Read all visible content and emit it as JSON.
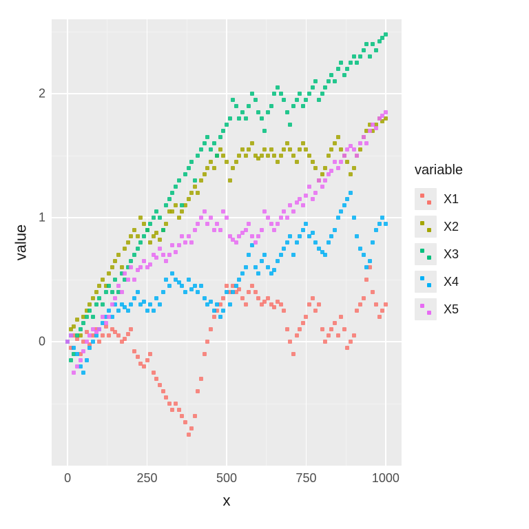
{
  "chart_data": {
    "type": "scatter",
    "xlabel": "x",
    "ylabel": "value",
    "legend_title": "variable",
    "xlim": [
      -50,
      1050
    ],
    "ylim": [
      -1.0,
      2.6
    ],
    "x_ticks": [
      0,
      250,
      500,
      750,
      1000
    ],
    "y_ticks": [
      0,
      1,
      2
    ],
    "x_minor": [
      125,
      375,
      625,
      875
    ],
    "y_minor": [
      -0.5,
      0.5,
      1.5,
      2.5
    ],
    "colors": {
      "X1": "#F8766D",
      "X2": "#A3A500",
      "X3": "#00BF7D",
      "X4": "#00B0F6",
      "X5": "#E76BF3"
    },
    "series": [
      {
        "name": "X1",
        "x": [
          0,
          10,
          20,
          30,
          40,
          50,
          60,
          70,
          80,
          90,
          100,
          110,
          120,
          130,
          140,
          150,
          160,
          170,
          180,
          190,
          200,
          210,
          220,
          230,
          240,
          250,
          260,
          270,
          280,
          290,
          300,
          310,
          320,
          330,
          340,
          350,
          360,
          370,
          380,
          390,
          400,
          410,
          420,
          430,
          440,
          450,
          460,
          470,
          480,
          490,
          500,
          510,
          520,
          530,
          540,
          550,
          560,
          570,
          580,
          590,
          600,
          610,
          620,
          630,
          640,
          650,
          660,
          670,
          680,
          690,
          700,
          710,
          720,
          730,
          740,
          750,
          760,
          770,
          780,
          790,
          800,
          810,
          820,
          830,
          840,
          850,
          860,
          870,
          880,
          890,
          900,
          910,
          920,
          930,
          940,
          950,
          960,
          970,
          980,
          990,
          1000
        ],
        "y": [
          0.0,
          -0.05,
          0.05,
          0.02,
          -0.1,
          0.0,
          0.08,
          -0.02,
          0.05,
          0.1,
          0.0,
          0.05,
          0.12,
          0.05,
          0.1,
          0.08,
          0.05,
          0.0,
          0.02,
          0.06,
          0.1,
          -0.08,
          -0.12,
          -0.18,
          -0.2,
          -0.15,
          -0.1,
          -0.25,
          -0.3,
          -0.35,
          -0.4,
          -0.45,
          -0.5,
          -0.55,
          -0.5,
          -0.55,
          -0.6,
          -0.65,
          -0.75,
          -0.7,
          -0.6,
          -0.4,
          -0.3,
          -0.1,
          0.0,
          0.1,
          0.2,
          0.25,
          0.3,
          0.35,
          0.45,
          0.4,
          0.45,
          0.4,
          0.42,
          0.35,
          0.3,
          0.4,
          0.45,
          0.4,
          0.35,
          0.3,
          0.32,
          0.35,
          0.3,
          0.28,
          0.32,
          0.3,
          0.25,
          0.1,
          0.0,
          -0.1,
          0.05,
          0.1,
          0.15,
          0.2,
          0.3,
          0.35,
          0.25,
          0.3,
          0.1,
          0.0,
          0.05,
          0.1,
          0.15,
          0.05,
          0.2,
          0.1,
          -0.05,
          0.0,
          0.05,
          0.25,
          0.3,
          0.35,
          0.5,
          0.6,
          0.4,
          0.3,
          0.2,
          0.25,
          0.3
        ]
      },
      {
        "name": "X2",
        "x": [
          0,
          10,
          20,
          30,
          40,
          50,
          60,
          70,
          80,
          90,
          100,
          110,
          120,
          130,
          140,
          150,
          160,
          170,
          180,
          190,
          200,
          210,
          220,
          230,
          240,
          250,
          260,
          270,
          280,
          290,
          300,
          310,
          320,
          330,
          340,
          350,
          360,
          370,
          380,
          390,
          400,
          410,
          420,
          430,
          440,
          450,
          460,
          470,
          480,
          490,
          500,
          510,
          520,
          530,
          540,
          550,
          560,
          570,
          580,
          590,
          600,
          610,
          620,
          630,
          640,
          650,
          660,
          670,
          680,
          690,
          700,
          710,
          720,
          730,
          740,
          750,
          760,
          770,
          780,
          790,
          800,
          810,
          820,
          830,
          840,
          850,
          860,
          870,
          880,
          890,
          900,
          910,
          920,
          930,
          940,
          950,
          960,
          970,
          980,
          990,
          1000
        ],
        "y": [
          0.0,
          0.1,
          0.12,
          0.18,
          0.05,
          0.2,
          0.25,
          0.3,
          0.35,
          0.4,
          0.45,
          0.5,
          0.45,
          0.55,
          0.6,
          0.65,
          0.7,
          0.6,
          0.75,
          0.8,
          0.85,
          0.9,
          0.85,
          1.0,
          0.95,
          0.9,
          0.8,
          0.85,
          0.88,
          0.82,
          0.9,
          0.95,
          1.05,
          1.05,
          1.1,
          1.0,
          1.05,
          1.1,
          1.15,
          1.2,
          1.25,
          1.2,
          1.3,
          1.35,
          1.4,
          1.45,
          1.4,
          1.5,
          1.55,
          1.5,
          1.45,
          1.3,
          1.4,
          1.45,
          1.5,
          1.55,
          1.5,
          1.55,
          1.6,
          1.5,
          1.48,
          1.5,
          1.55,
          1.5,
          1.55,
          1.5,
          1.45,
          1.5,
          1.55,
          1.6,
          1.55,
          1.5,
          1.45,
          1.55,
          1.6,
          1.55,
          1.5,
          1.45,
          1.4,
          1.3,
          1.35,
          1.4,
          1.5,
          1.55,
          1.6,
          1.65,
          1.55,
          1.5,
          1.45,
          1.35,
          1.4,
          1.5,
          1.55,
          1.65,
          1.7,
          1.75,
          1.7,
          1.75,
          1.8,
          1.78,
          1.8
        ]
      },
      {
        "name": "X3",
        "x": [
          0,
          10,
          20,
          30,
          40,
          50,
          60,
          70,
          80,
          90,
          100,
          110,
          120,
          130,
          140,
          150,
          160,
          170,
          180,
          190,
          200,
          210,
          220,
          230,
          240,
          250,
          260,
          270,
          280,
          290,
          300,
          310,
          320,
          330,
          340,
          350,
          360,
          370,
          380,
          390,
          400,
          410,
          420,
          430,
          440,
          450,
          460,
          470,
          480,
          490,
          500,
          510,
          520,
          530,
          540,
          550,
          560,
          570,
          580,
          590,
          600,
          610,
          620,
          630,
          640,
          650,
          660,
          670,
          680,
          690,
          700,
          710,
          720,
          730,
          740,
          750,
          760,
          770,
          780,
          790,
          800,
          810,
          820,
          830,
          840,
          850,
          860,
          870,
          880,
          890,
          900,
          910,
          920,
          930,
          940,
          950,
          960,
          970,
          980,
          990,
          1000
        ],
        "y": [
          0.0,
          -0.15,
          -0.1,
          0.05,
          0.1,
          0.15,
          0.2,
          0.25,
          0.2,
          0.3,
          0.35,
          0.3,
          0.4,
          0.45,
          0.4,
          0.5,
          0.4,
          0.55,
          0.5,
          0.6,
          0.65,
          0.7,
          0.75,
          0.8,
          0.85,
          0.9,
          0.95,
          1.0,
          1.05,
          1.0,
          0.9,
          1.1,
          1.15,
          1.2,
          1.25,
          1.3,
          1.1,
          1.35,
          1.4,
          1.45,
          1.3,
          1.5,
          1.55,
          1.6,
          1.65,
          1.55,
          1.6,
          1.5,
          1.65,
          1.7,
          1.75,
          1.8,
          1.95,
          1.9,
          1.8,
          1.85,
          1.8,
          1.9,
          2.0,
          1.95,
          1.85,
          1.8,
          1.7,
          1.85,
          1.9,
          2.0,
          2.05,
          2.0,
          1.95,
          1.85,
          1.75,
          1.9,
          1.95,
          2.0,
          1.9,
          1.95,
          2.0,
          2.05,
          2.1,
          1.95,
          2.0,
          2.05,
          2.1,
          2.15,
          2.1,
          2.2,
          2.25,
          2.15,
          2.2,
          2.25,
          2.3,
          2.25,
          2.3,
          2.35,
          2.4,
          2.3,
          2.4,
          2.35,
          2.42,
          2.45,
          2.48
        ]
      },
      {
        "name": "X4",
        "x": [
          0,
          10,
          20,
          30,
          40,
          50,
          60,
          70,
          80,
          90,
          100,
          110,
          120,
          130,
          140,
          150,
          160,
          170,
          180,
          190,
          200,
          210,
          220,
          230,
          240,
          250,
          260,
          270,
          280,
          290,
          300,
          310,
          320,
          330,
          340,
          350,
          360,
          370,
          380,
          390,
          400,
          410,
          420,
          430,
          440,
          450,
          460,
          470,
          480,
          490,
          500,
          510,
          520,
          530,
          540,
          550,
          560,
          570,
          580,
          590,
          600,
          610,
          620,
          630,
          640,
          650,
          660,
          670,
          680,
          690,
          700,
          710,
          720,
          730,
          740,
          750,
          760,
          770,
          780,
          790,
          800,
          810,
          820,
          830,
          840,
          850,
          860,
          870,
          880,
          890,
          900,
          910,
          920,
          930,
          940,
          950,
          960,
          970,
          980,
          990,
          1000
        ],
        "y": [
          0.0,
          0.05,
          -0.05,
          -0.1,
          -0.2,
          -0.25,
          -0.15,
          -0.05,
          0.0,
          0.05,
          0.1,
          0.15,
          0.2,
          0.25,
          0.2,
          0.3,
          0.25,
          0.3,
          0.28,
          0.25,
          0.3,
          0.35,
          0.4,
          0.3,
          0.32,
          0.25,
          0.3,
          0.25,
          0.35,
          0.3,
          0.4,
          0.5,
          0.45,
          0.55,
          0.5,
          0.48,
          0.45,
          0.4,
          0.5,
          0.42,
          0.45,
          0.4,
          0.45,
          0.35,
          0.3,
          0.32,
          0.25,
          0.3,
          0.2,
          0.25,
          0.4,
          0.3,
          0.4,
          0.45,
          0.5,
          0.55,
          0.6,
          0.7,
          0.78,
          0.6,
          0.55,
          0.65,
          0.7,
          0.6,
          0.55,
          0.58,
          0.65,
          0.7,
          0.75,
          0.8,
          0.85,
          0.7,
          0.8,
          0.85,
          0.9,
          0.95,
          0.85,
          0.88,
          0.8,
          0.75,
          0.72,
          0.7,
          0.8,
          0.85,
          0.9,
          1.0,
          1.05,
          1.1,
          1.15,
          1.2,
          1.0,
          0.85,
          0.75,
          0.7,
          0.6,
          0.65,
          0.8,
          0.9,
          0.95,
          1.0,
          0.95
        ]
      },
      {
        "name": "X5",
        "x": [
          0,
          10,
          20,
          30,
          40,
          50,
          60,
          70,
          80,
          90,
          100,
          110,
          120,
          130,
          140,
          150,
          160,
          170,
          180,
          190,
          200,
          210,
          220,
          230,
          240,
          250,
          260,
          270,
          280,
          290,
          300,
          310,
          320,
          330,
          340,
          350,
          360,
          370,
          380,
          390,
          400,
          410,
          420,
          430,
          440,
          450,
          460,
          470,
          480,
          490,
          500,
          510,
          520,
          530,
          540,
          550,
          560,
          570,
          580,
          590,
          600,
          610,
          620,
          630,
          640,
          650,
          660,
          670,
          680,
          690,
          700,
          710,
          720,
          730,
          740,
          750,
          760,
          770,
          780,
          790,
          800,
          810,
          820,
          830,
          840,
          850,
          860,
          870,
          880,
          890,
          900,
          910,
          920,
          930,
          940,
          950,
          960,
          970,
          980,
          990,
          1000
        ],
        "y": [
          0.0,
          0.05,
          -0.25,
          -0.2,
          -0.15,
          -0.08,
          0.0,
          0.05,
          0.1,
          0.08,
          0.1,
          0.2,
          0.15,
          0.2,
          0.3,
          0.35,
          0.45,
          0.4,
          0.55,
          0.5,
          0.6,
          0.5,
          0.58,
          0.6,
          0.65,
          0.6,
          0.62,
          0.7,
          0.68,
          0.75,
          0.7,
          0.65,
          0.7,
          0.78,
          0.72,
          0.78,
          0.85,
          0.8,
          0.85,
          0.8,
          0.9,
          0.95,
          1.0,
          1.05,
          0.95,
          1.0,
          0.9,
          0.95,
          0.9,
          1.05,
          1.0,
          0.85,
          0.82,
          0.8,
          0.85,
          0.88,
          0.9,
          0.95,
          0.85,
          0.8,
          0.85,
          0.9,
          1.05,
          1.0,
          0.95,
          0.9,
          0.95,
          1.0,
          1.05,
          1.0,
          1.1,
          1.05,
          1.12,
          1.15,
          1.1,
          1.18,
          1.25,
          1.15,
          1.2,
          1.3,
          1.25,
          1.3,
          1.35,
          1.38,
          1.45,
          1.4,
          1.45,
          1.5,
          1.55,
          1.58,
          1.55,
          1.5,
          1.6,
          1.65,
          1.6,
          1.7,
          1.75,
          1.72,
          1.8,
          1.82,
          1.85
        ]
      }
    ]
  }
}
